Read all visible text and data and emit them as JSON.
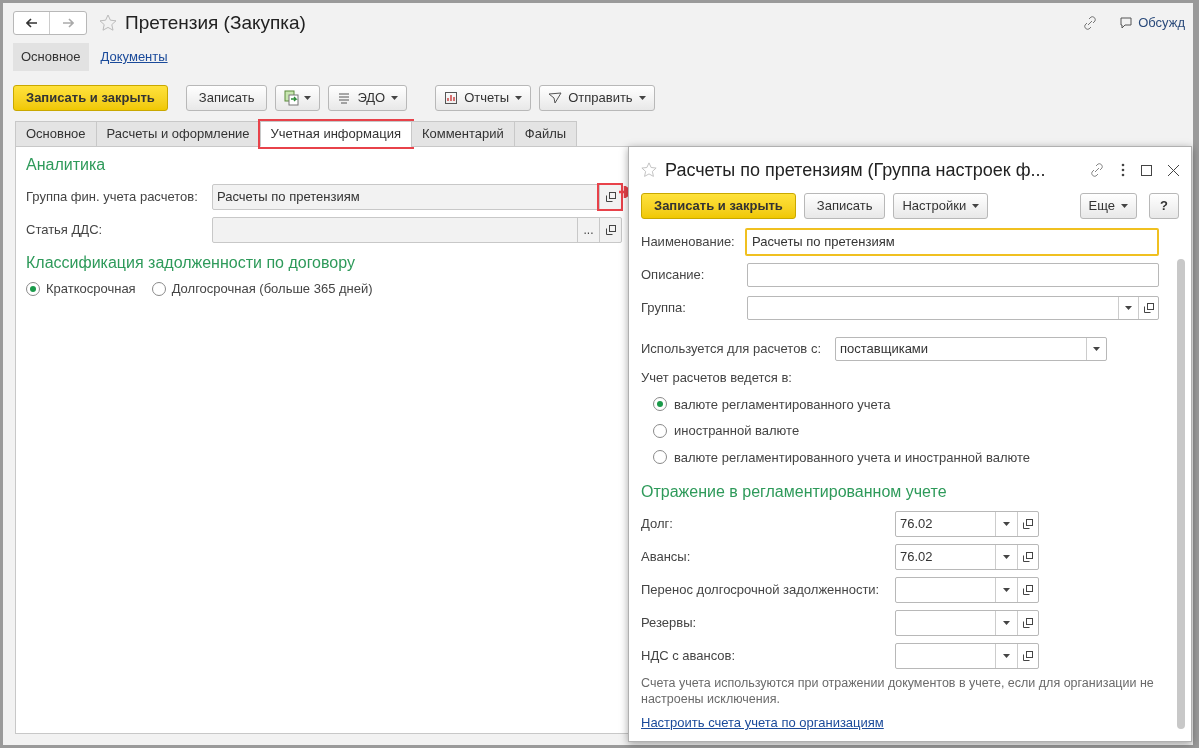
{
  "window": {
    "title": "Претензия (Закупка)",
    "discussion": "Обсужд"
  },
  "page_tabs": [
    {
      "label": "Основное",
      "selected": true
    },
    {
      "label": "Документы",
      "selected": false
    }
  ],
  "toolbar": [
    {
      "kind": "primary",
      "label": "Записать и закрыть"
    },
    {
      "kind": "plain",
      "label": "Записать"
    },
    {
      "kind": "icon-menu"
    },
    {
      "kind": "edo-menu",
      "label": "ЭДО"
    },
    {
      "kind": "report-menu",
      "label": "Отчеты"
    },
    {
      "kind": "send-menu",
      "label": "Отправить"
    }
  ],
  "tabs": [
    {
      "label": "Основное",
      "selected": false,
      "highlighted": false
    },
    {
      "label": "Расчеты и оформление",
      "selected": false,
      "highlighted": false
    },
    {
      "label": "Учетная информация",
      "selected": true,
      "highlighted": true
    },
    {
      "label": "Комментарий",
      "selected": false,
      "highlighted": false
    },
    {
      "label": "Файлы",
      "selected": false,
      "highlighted": false
    }
  ],
  "analytics": {
    "heading": "Аналитика",
    "fields": [
      {
        "label": "Группа фин. учета расчетов:",
        "value": "Расчеты по претензиям",
        "highlighted": true
      },
      {
        "label": "Статья ДДС:",
        "select_button": "...",
        "highlighted": false
      }
    ]
  },
  "classification": {
    "heading": "Классификация задолженности по договору",
    "options": [
      {
        "label": "Краткосрочная",
        "selected": true
      },
      {
        "label": "Долгосрочная (больше 365 дней)",
        "selected": false
      }
    ]
  },
  "dialog": {
    "title": "Расчеты по претензиям (Группа настроек ф...",
    "toolbar": [
      {
        "kind": "primary",
        "label": "Записать и закрыть"
      },
      {
        "kind": "plain",
        "label": "Записать"
      },
      {
        "kind": "menu",
        "label": "Настройки"
      }
    ],
    "more": "Еще",
    "help": "?",
    "name": {
      "label": "Наименование:",
      "value": "Расчеты по претензиям"
    },
    "description": {
      "label": "Описание:"
    },
    "group": {
      "label": "Группа:"
    },
    "used_for": {
      "label": "Используется для расчетов с:",
      "value": "поставщиками"
    },
    "currency": {
      "label": "Учет расчетов ведется в:",
      "options": [
        {
          "label": "валюте регламентированного учета",
          "selected": true
        },
        {
          "label": "иностранной валюте",
          "selected": false
        },
        {
          "label": "валюте регламентированного учета и иностранной валюте",
          "selected": false
        }
      ]
    },
    "accounting": {
      "heading": "Отражение в регламентированном учете",
      "fields": [
        {
          "label": "Долг:",
          "value": "76.02"
        },
        {
          "label": "Авансы:",
          "value": "76.02"
        },
        {
          "label": "Перенос долгосрочной задолженности:"
        },
        {
          "label": "Резервы:"
        },
        {
          "label": "НДС с авансов:"
        }
      ]
    },
    "note": "Счета учета используются при отражении документов в учете, если для организации не настроены исключения.",
    "link": "Настроить счета учета по организациям"
  }
}
